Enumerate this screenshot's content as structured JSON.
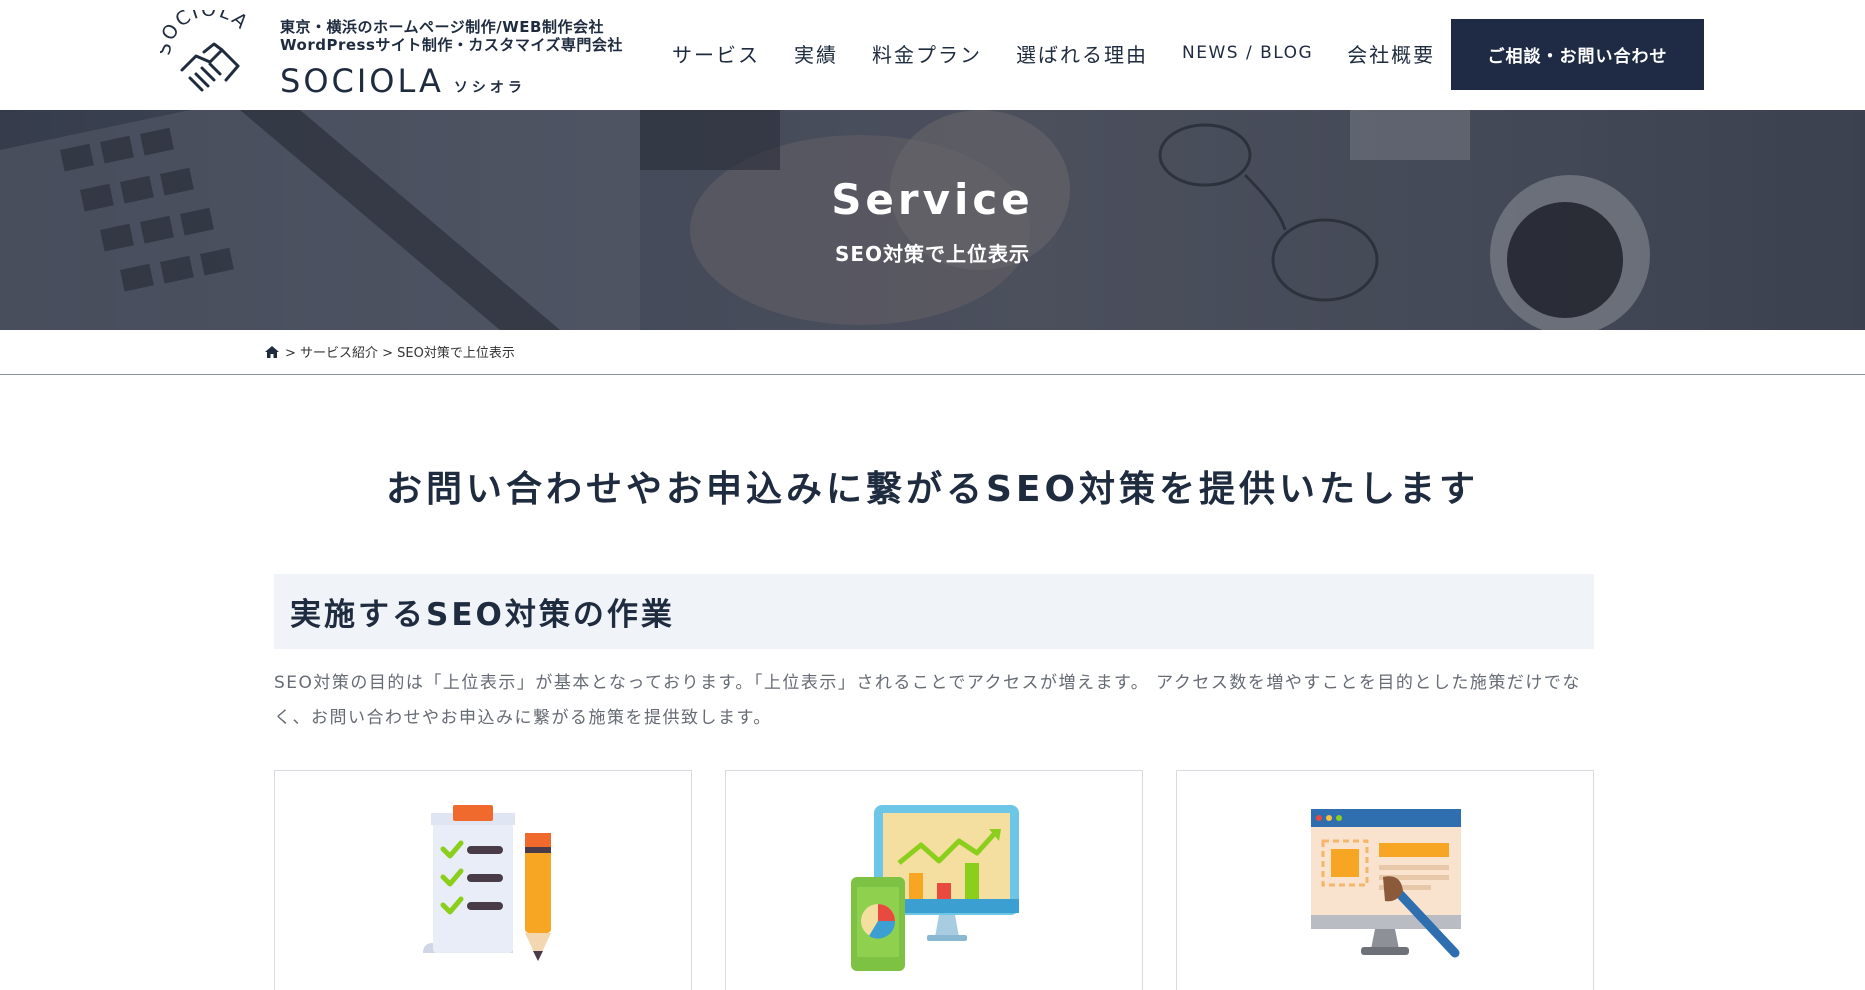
{
  "header": {
    "tagline_1": "東京・横浜のホームページ制作/WEB制作会社",
    "tagline_2": "WordPressサイト制作・カスタマイズ専門会社",
    "brand_name": "SOCIOLA",
    "brand_kana": "ソシオラ",
    "logo_arc_text": "SOCIOLA",
    "nav": [
      "サービス",
      "実績",
      "料金プラン",
      "選ばれる理由",
      "NEWS / BLOG",
      "会社概要"
    ],
    "cta_label": "ご相談・お問い合わせ"
  },
  "hero": {
    "title": "Service",
    "subtitle": "SEO対策で上位表示"
  },
  "breadcrumb": {
    "home_icon": "home-icon",
    "trail": "> サービス紹介 > SEO対策で上位表示"
  },
  "main": {
    "title": "お問い合わせやお申込みに繋がるSEO対策を提供いたします",
    "section_heading": "実施するSEO対策の作業",
    "section_body": "SEO対策の目的は「上位表示」が基本となっております。「上位表示」されることでアクセスが増えます。 アクセス数を増やすことを目的とした施策だけでなく、お問い合わせやお申込みに繋がる施策を提供致します。",
    "cards": [
      {
        "icon": "checklist-icon"
      },
      {
        "icon": "analytics-monitor-icon"
      },
      {
        "icon": "web-design-icon"
      }
    ]
  },
  "colors": {
    "navy": "#1f2b45",
    "section_bg": "#f0f4f9",
    "body_text": "#666b74"
  }
}
